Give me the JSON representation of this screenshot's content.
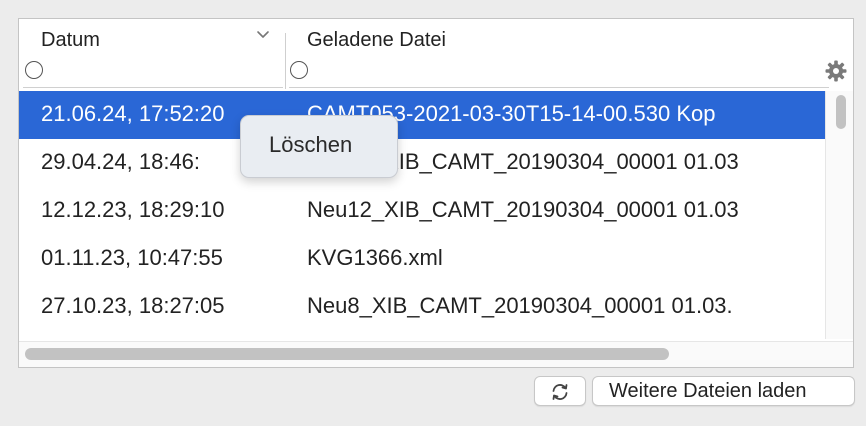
{
  "table": {
    "columns": [
      {
        "label": "Datum"
      },
      {
        "label": "Geladene Datei"
      }
    ],
    "rows": [
      {
        "date": "21.06.24, 17:52:20",
        "file": "CAMT053-2021-03-30T15-14-00.530 Kop",
        "selected": true
      },
      {
        "date": "29.04.24, 18:46:",
        "file": "Neu13_XIB_CAMT_20190304_00001 01.03",
        "selected": false
      },
      {
        "date": "12.12.23, 18:29:10",
        "file": "Neu12_XIB_CAMT_20190304_00001 01.03",
        "selected": false
      },
      {
        "date": "01.11.23, 10:47:55",
        "file": "KVG1366.xml",
        "selected": false
      },
      {
        "date": "27.10.23, 18:27:05",
        "file": "Neu8_XIB_CAMT_20190304_00001 01.03.",
        "selected": false
      }
    ]
  },
  "context_menu": {
    "items": [
      {
        "label": "Löschen"
      }
    ]
  },
  "footer": {
    "refresh_icon": "refresh-icon",
    "load_more_label": "Weitere Dateien laden"
  },
  "icons": {
    "sort": "chevron-down-icon",
    "settings": "gear-icon"
  },
  "colors": {
    "selection": "#2a67d6",
    "background": "#ececec"
  }
}
